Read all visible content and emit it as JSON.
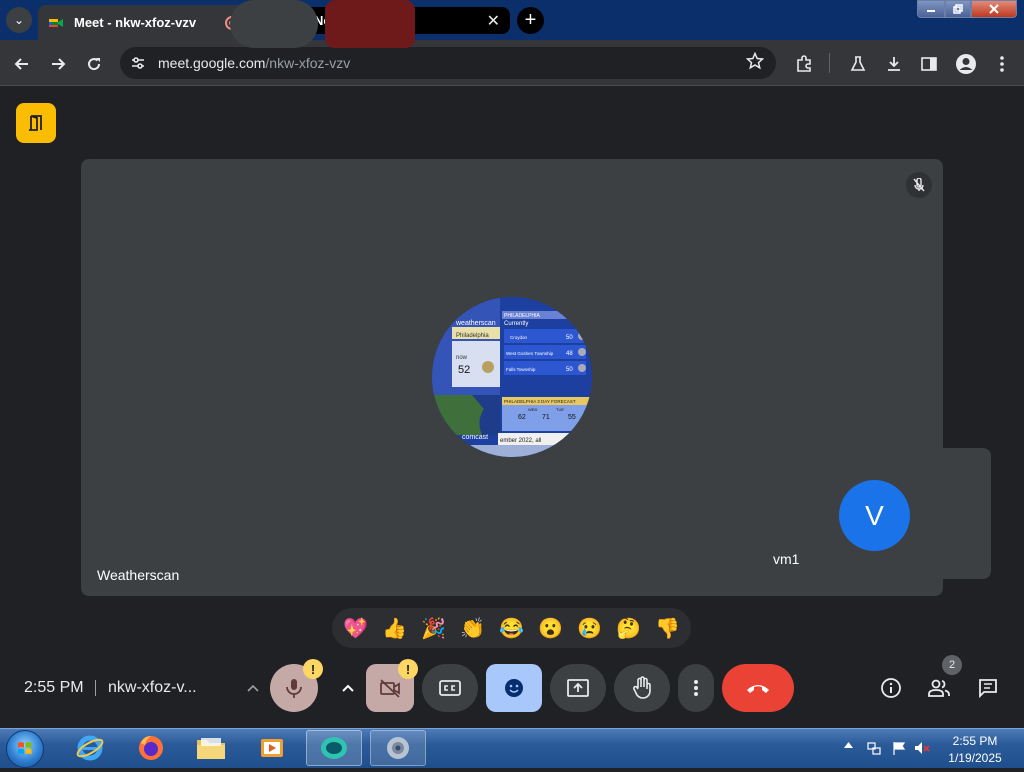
{
  "browser": {
    "tabs": [
      {
        "title": "Meet - nkw-xfoz-vzv"
      },
      {
        "title": "New Tab"
      }
    ],
    "close_glyph": "✕",
    "new_tab_glyph": "+",
    "url": {
      "host": "meet.google.com",
      "path": "/nkw-xfoz-vzv"
    }
  },
  "meet": {
    "main_participant": {
      "name": "Weatherscan",
      "weather": {
        "brand": "weatherscan",
        "city": "Philadelphia",
        "now_label": "now",
        "temp": "52",
        "header": "PHILADELPHIA",
        "currently": "Currently",
        "locations": [
          {
            "name": "Croydon",
            "temp": "50"
          },
          {
            "name": "West Goshen Township",
            "temp": "48"
          },
          {
            "name": "Falls Township",
            "temp": "50"
          }
        ],
        "forecast_header": "PHILADELPHIA 3 DAY FORECAST",
        "forecast": [
          {
            "day": "",
            "hi": "62"
          },
          {
            "day": "WED",
            "hi": "71"
          },
          {
            "day": "TUE",
            "hi": "55"
          }
        ],
        "sponsor": "comcast",
        "ticker": "ember 2022, all"
      }
    },
    "self_participant": {
      "name": "vm1",
      "initial": "V"
    },
    "reactions": [
      "💖",
      "👍",
      "🎉",
      "👏",
      "😂",
      "😮",
      "😢",
      "🤔",
      "👎"
    ],
    "time": "2:55 PM",
    "meeting_code": "nkw-xfoz-v...",
    "warn_glyph": "!",
    "people_count": "2"
  },
  "colors": {
    "leave": "#ea4335",
    "emoji_active": "#a8c7fa",
    "camera_off": "#6e1a1a",
    "warning": "#fdd663",
    "avatar": "#1a73e8"
  },
  "taskbar": {
    "time": "2:55 PM",
    "date": "1/19/2025"
  }
}
